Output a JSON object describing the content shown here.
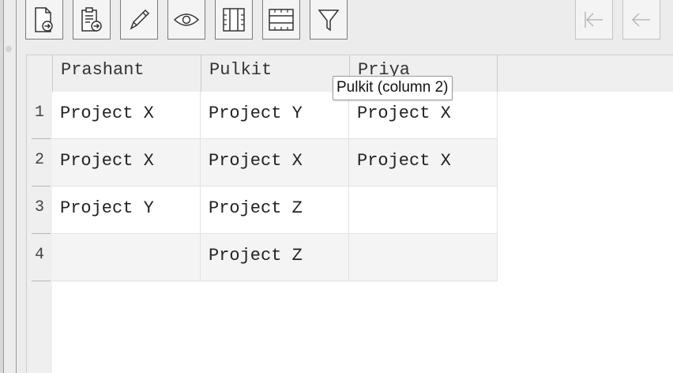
{
  "toolbar": {
    "buttons": [
      {
        "icon": "new-document-icon",
        "enabled": true
      },
      {
        "icon": "paste-document-icon",
        "enabled": true
      },
      {
        "icon": "pencil-icon",
        "enabled": true
      },
      {
        "icon": "eye-icon",
        "enabled": true
      },
      {
        "icon": "columns-icon",
        "enabled": true
      },
      {
        "icon": "rows-icon",
        "enabled": true
      },
      {
        "icon": "filter-icon",
        "enabled": true
      },
      {
        "icon": "first-page-icon",
        "enabled": false
      },
      {
        "icon": "previous-page-icon",
        "enabled": false
      }
    ]
  },
  "table": {
    "columns": [
      "Prashant",
      "Pulkit",
      "Priya"
    ],
    "row_numbers": [
      "1",
      "2",
      "3",
      "4"
    ],
    "rows": [
      [
        "Project X",
        "Project Y",
        "Project X"
      ],
      [
        "Project X",
        "Project X",
        "Project X"
      ],
      [
        "Project Y",
        "Project Z",
        ""
      ],
      [
        "",
        "Project Z",
        ""
      ]
    ]
  },
  "tooltip": {
    "text": "Pulkit (column 2)"
  }
}
